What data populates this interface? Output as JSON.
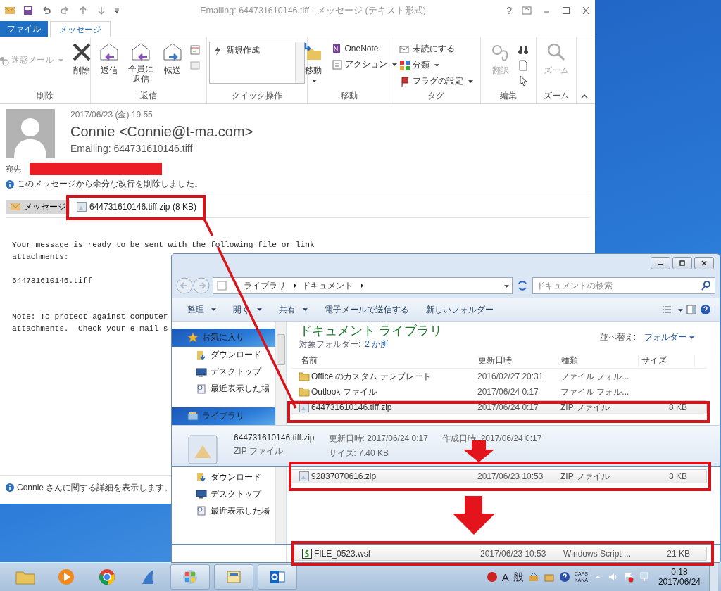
{
  "outlook": {
    "title": "Emailing: 644731610146.tiff - メッセージ (テキスト形式)",
    "help": "?",
    "tabs": [
      {
        "label": "ファイル",
        "kind": "backstage",
        "selected": false
      },
      {
        "label": "メッセージ",
        "kind": "tab",
        "selected": true
      }
    ],
    "ribbon": {
      "delete_group": {
        "label": "削除",
        "junk_mail": {
          "label": "迷惑メール",
          "disabled": true
        },
        "delete": "削除"
      },
      "reply_group": {
        "label": "返信",
        "reply": "返信",
        "reply_all": "全員に返信",
        "forward": "転送"
      },
      "quick_steps_group": {
        "label": "クイック操作",
        "items": [
          "新規作成"
        ]
      },
      "move_group": {
        "label": "移動",
        "move": "移動",
        "onenote": "OneNote",
        "actions": "アクション"
      },
      "tags_group": {
        "label": "タグ",
        "unread": "未読にする",
        "categorize": "分類",
        "follow_up": "フラグの設定"
      },
      "editing_group": {
        "label": "編集",
        "translate": {
          "label": "翻訳",
          "disabled": true
        }
      },
      "zoom_group": {
        "label": "ズーム",
        "zoom": {
          "label": "ズーム",
          "disabled": true
        }
      }
    },
    "message": {
      "date": "2017/06/23 (金) 19:55",
      "sender": "Connie <Connie@t-ma.com>",
      "subject": "Emailing: 644731610146.tiff",
      "to_label": "宛先",
      "info": "このメッセージから余分な改行を削除しました。",
      "message_tab": {
        "label": "メッセージ",
        "selected": true
      },
      "attachment": "644731610146.tiff.zip (8 KB)",
      "body": [
        "Your message is ready to be sent with the following file or link\nattachments:",
        "644731610146.tiff",
        "Note: To protect against computer\nattachments.  Check your e-mail s"
      ]
    },
    "footer": "Connie さんに関する詳細を表示します。"
  },
  "explorer": {
    "breadcrumb": [
      "ライブラリ",
      "ドキュメント"
    ],
    "search": {
      "placeholder": "ドキュメントの検索"
    },
    "toolbar": [
      {
        "label": "整理",
        "dropdown": true
      },
      {
        "label": "開く",
        "dropdown": true
      },
      {
        "label": "共有",
        "dropdown": true
      },
      {
        "label": "電子メールで送信する",
        "dropdown": false
      },
      {
        "label": "新しいフォルダー",
        "dropdown": false
      }
    ],
    "nav": [
      {
        "label": "お気に入り",
        "kind": "favorites",
        "children": [
          {
            "label": "ダウンロード",
            "kind": "download"
          },
          {
            "label": "デスクトップ",
            "kind": "desktop"
          },
          {
            "label": "最近表示した場",
            "kind": "recent"
          }
        ]
      },
      {
        "label": "ライブラリ",
        "kind": "library"
      }
    ],
    "library_title": "ドキュメント ライブラリ",
    "includes_label": "対象フォルダー:",
    "includes_link": "2 か所",
    "arrange_label": "並べ替え:",
    "arrange_value": "フォルダー",
    "columns": [
      "名前",
      "更新日時",
      "種類",
      "サイズ"
    ],
    "rows": [
      {
        "kind": "folder",
        "name": "Office のカスタム テンプレート",
        "date": "2016/02/27 20:31",
        "type": "ファイル フォル...",
        "selected": false
      },
      {
        "kind": "folder",
        "name": "Outlook ファイル",
        "date": "2017/06/24 0:17",
        "type": "ファイル フォル...",
        "selected": false
      },
      {
        "kind": "zip",
        "name": "644731610146.tiff.zip",
        "date": "2017/06/24 0:17",
        "type": "ZIP ファイル",
        "size": "8 KB",
        "selected": true
      }
    ],
    "details": {
      "name": "644731610146.tiff.zip",
      "type": "ZIP ファイル",
      "modified": "更新日時: 2017/06/24 0:17",
      "created": "作成日時: 2017/06/24 0:17",
      "size": "サイズ: 7.40 KB"
    }
  },
  "explorer_crop_1": {
    "nav": [
      {
        "label": "ダウンロード",
        "kind": "download"
      },
      {
        "label": "デスクトップ",
        "kind": "desktop"
      },
      {
        "label": "最近表示した場",
        "kind": "recent"
      }
    ],
    "rows": [
      {
        "kind": "zip",
        "name": "92837070616.zip",
        "date": "2017/06/23 10:53",
        "type": "ZIP ファイル",
        "size": "8 KB",
        "selected": true
      }
    ]
  },
  "explorer_crop_2": {
    "rows": [
      {
        "kind": "script",
        "name": "FILE_0523.wsf",
        "date": "2017/06/23 10:53",
        "type": "Windows Script ...",
        "size": "21 KB",
        "selected": true
      }
    ]
  },
  "taskbar": {
    "ime_mode": "A",
    "ime_kanji": "般",
    "caps": "CAPS",
    "kana": "KANA",
    "time": "0:18",
    "date": "2017/06/24"
  }
}
